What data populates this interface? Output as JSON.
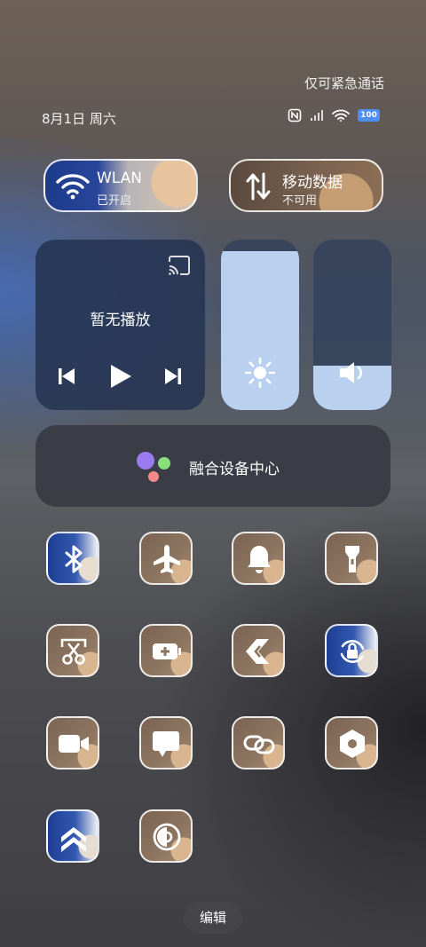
{
  "status": {
    "emergency_text": "仅可紧急通话",
    "date": "8月1日 周六",
    "battery": "100",
    "icons": [
      "nfc-icon",
      "signal-icon",
      "wifi-icon",
      "battery-icon"
    ]
  },
  "wlan": {
    "title": "WLAN",
    "status": "已开启"
  },
  "mobile_data": {
    "title": "移动数据",
    "status": "不可用"
  },
  "media": {
    "now_playing": "暂无播放"
  },
  "brightness": {
    "level": 0.93
  },
  "volume": {
    "level": 0.26
  },
  "fusion": {
    "label": "融合设备中心"
  },
  "tiles": [
    {
      "name": "bluetooth",
      "active": true
    },
    {
      "name": "airplane-mode",
      "active": false
    },
    {
      "name": "silent-mode",
      "active": false
    },
    {
      "name": "flashlight",
      "active": false
    },
    {
      "name": "screenshot",
      "active": false
    },
    {
      "name": "battery-saver",
      "active": false
    },
    {
      "name": "share",
      "active": false
    },
    {
      "name": "auto-rotate-lock",
      "active": true
    },
    {
      "name": "screen-recorder",
      "active": false
    },
    {
      "name": "screen-cast",
      "active": false
    },
    {
      "name": "link-sharing",
      "active": false
    },
    {
      "name": "settings",
      "active": false
    },
    {
      "name": "super-mode",
      "active": true
    },
    {
      "name": "eye-comfort",
      "active": false
    }
  ],
  "edit_label": "编辑",
  "colors": {
    "accent": "#4d8ff0",
    "slider_fill": "#b9d0ee"
  }
}
